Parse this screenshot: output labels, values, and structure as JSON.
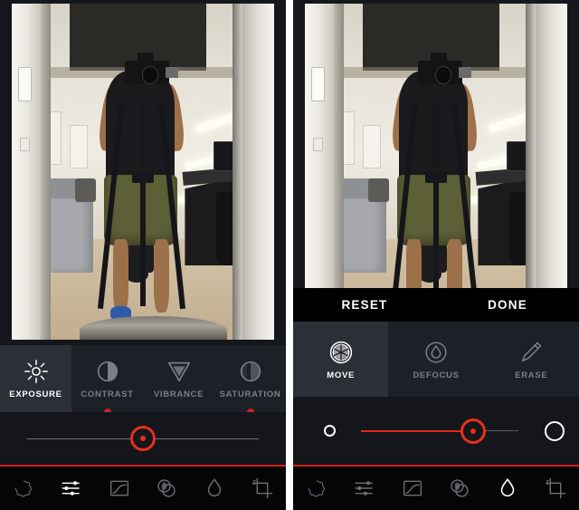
{
  "app": {
    "name": "photo-editor",
    "accent_red": "#e0281b",
    "panel_bg": "#000000",
    "toolstrip_bg": "#1d2026",
    "toolstrip_active_bg": "#2b2f36",
    "slider_bg": "#14161b",
    "nav_bg": "#050506"
  },
  "left_screen": {
    "photo": {
      "alt": "Mirror selfie of a photographer holding a DSLR camera mounted on a tripod, standing in a doorway of an office room with a grey sofa, desk and chairs"
    },
    "adjust_tools": [
      {
        "label": "EXPOSURE",
        "icon": "sun-icon",
        "active": true,
        "marker": false
      },
      {
        "label": "CONTRAST",
        "icon": "contrast-icon",
        "active": false,
        "marker": true
      },
      {
        "label": "VIBRANCE",
        "icon": "vibrance-icon",
        "active": false,
        "marker": false
      },
      {
        "label": "SATURATION",
        "icon": "saturation-icon",
        "active": false,
        "marker": true
      }
    ],
    "slider": {
      "name": "exposure-slider",
      "value_position_pct": 50,
      "track_style": "plain",
      "knob_color": "#e8301c"
    },
    "bottom_nav": [
      {
        "icon": "presets-icon",
        "active": false
      },
      {
        "icon": "adjust-icon",
        "active": true
      },
      {
        "icon": "curves-icon",
        "active": false
      },
      {
        "icon": "effects-icon",
        "active": false
      },
      {
        "icon": "defocus-icon",
        "active": false
      },
      {
        "icon": "crop-icon",
        "active": false
      }
    ]
  },
  "right_screen": {
    "photo": {
      "alt": "Same mirror selfie photograph shown with the defocus tool overlay"
    },
    "action_bar": {
      "reset_label": "RESET",
      "done_label": "DONE"
    },
    "defocus_tools": [
      {
        "label": "MOVE",
        "icon": "aperture-icon",
        "active": true
      },
      {
        "label": "DEFOCUS",
        "icon": "drop-icon",
        "active": false
      },
      {
        "label": "ERASE",
        "icon": "pencil-icon",
        "active": false
      }
    ],
    "slider": {
      "name": "defocus-size-slider",
      "value_position_pct": 63,
      "track_style": "size",
      "min_cap_icon": "small-circle-icon",
      "max_cap_icon": "large-circle-icon",
      "knob_color": "#e8301c"
    },
    "bottom_nav": [
      {
        "icon": "presets-icon",
        "active": false
      },
      {
        "icon": "adjust-icon",
        "active": false
      },
      {
        "icon": "curves-icon",
        "active": false
      },
      {
        "icon": "effects-icon",
        "active": false
      },
      {
        "icon": "defocus-icon",
        "active": true
      },
      {
        "icon": "crop-icon",
        "active": false
      }
    ]
  }
}
